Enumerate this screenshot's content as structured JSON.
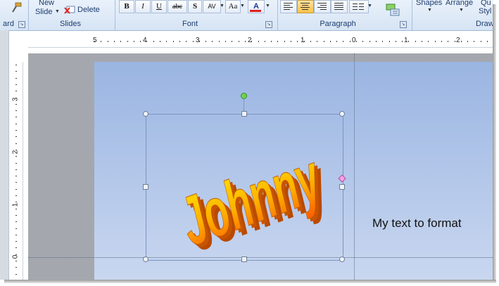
{
  "ribbon": {
    "groups": {
      "clipboard_label": "ard",
      "slides_label": "Slides",
      "font_label": "Font",
      "paragraph_label": "Paragraph",
      "drawing_label": "Draw"
    },
    "slides": {
      "new_slide_line1": "New",
      "new_slide_line2": "Slide",
      "delete_label": "Delete"
    },
    "font": {
      "bold": "B",
      "italic": "I",
      "underline": "U",
      "strike": "abc",
      "shadow": "S",
      "spacing": "AV",
      "change_case": "Aa",
      "font_color": "A"
    },
    "drawing": {
      "shapes": "Shapes",
      "arrange": "Arrange",
      "quick_styles_line1": "Qu",
      "quick_styles_line2": "Styl"
    }
  },
  "rulers": {
    "horizontal": [
      "5",
      "4",
      "3",
      "2",
      "1",
      "0",
      "1",
      "2"
    ],
    "vertical": [
      "3",
      "2",
      "1",
      "0"
    ]
  },
  "slide": {
    "wordart_text": "Johnny",
    "textbox": "My text to format"
  },
  "colors": {
    "wordart_top": "#ffe600",
    "wordart_bottom": "#ff6a00",
    "wordart_extrusion": "#b84a00",
    "font_color_bar": "#e02020",
    "slide_top": "#9ab5e2",
    "slide_bottom": "#c9d7f0"
  }
}
